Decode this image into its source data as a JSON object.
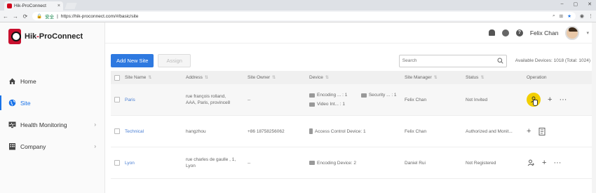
{
  "browser": {
    "tab_title": "Hik-ProConnect",
    "tab_close": "×",
    "secure_label": "安全",
    "url": "https://hik-proconnect.com/#/basic/site",
    "win_min": "–",
    "win_max": "▢",
    "win_close": "✕"
  },
  "app": {
    "logo_hik": "Hik",
    "logo_hyphen": "-",
    "logo_pro": "ProConnect"
  },
  "sidebar": {
    "items": [
      {
        "label": "Home",
        "icon": "home-icon"
      },
      {
        "label": "Site",
        "icon": "globe-icon"
      },
      {
        "label": "Health Monitoring",
        "icon": "monitor-icon"
      },
      {
        "label": "Company",
        "icon": "building-icon"
      }
    ]
  },
  "header": {
    "user_name": "Felix Chan"
  },
  "toolbar": {
    "add_label": "Add New Site",
    "assign_label": "Assign",
    "search_placeholder": "Search",
    "available_devices": "Available Devices: 1018 (Total: 1024)"
  },
  "table": {
    "columns": [
      "Site Name",
      "Address",
      "Site Owner",
      "Device",
      "Site Manager",
      "Status",
      "Operation"
    ],
    "rows": [
      {
        "name": "Paris",
        "address_line1": "rue françois rolland,",
        "address_line2": "AAA, Paris, province8",
        "owner": "--",
        "devices": [
          "Encoding ... : 1",
          "Security ... : 1",
          "Video Int... : 1"
        ],
        "manager": "Felix Chan",
        "status": "Not Invited"
      },
      {
        "name": "Technical",
        "address_line1": "hangzhou",
        "address_line2": "",
        "owner": "+86 18758256062",
        "devices": [
          "Access Control Device: 1"
        ],
        "manager": "Felix Chan",
        "status": "Authorized and Monit..."
      },
      {
        "name": "Lyon",
        "address_line1": "rue charles de gaulle , 1,",
        "address_line2": "Lyon",
        "owner": "--",
        "devices": [
          "Encoding Device: 2"
        ],
        "manager": "Daniel Rui",
        "status": "Not Registered"
      }
    ]
  },
  "colors": {
    "primary": "#2e79e0",
    "brand_red": "#c8102e",
    "highlight_yellow": "#f2cf00",
    "link": "#4a7fd4"
  }
}
